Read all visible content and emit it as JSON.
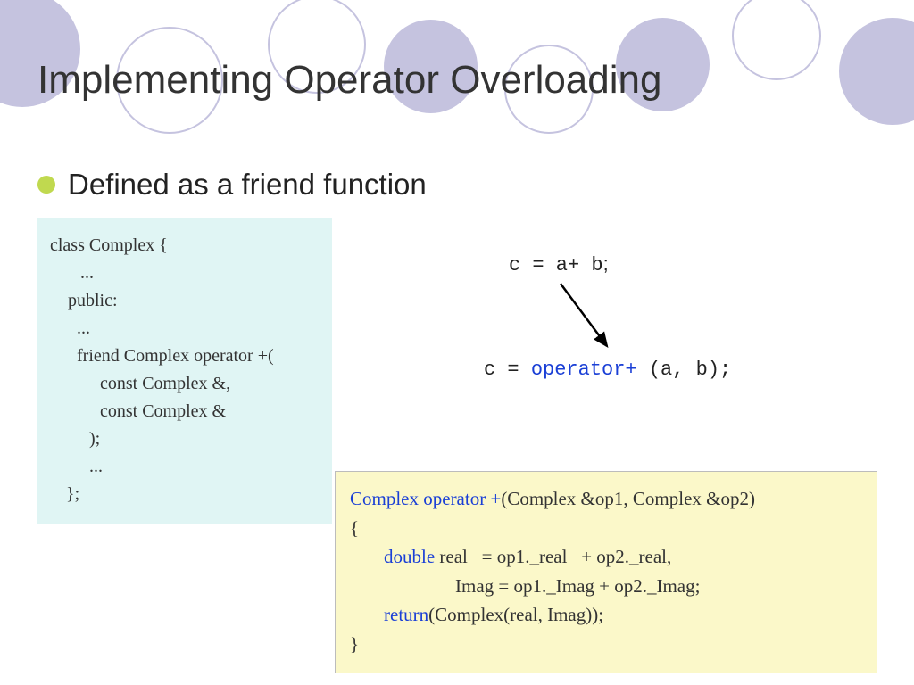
{
  "title": "Implementing Operator Overloading",
  "bullet": "Defined as a friend function",
  "classCode": {
    "l1": "class Complex {",
    "l2": "...",
    "l3": "public:",
    "l4": "...",
    "l5": "friend Complex operator +(",
    "l6": "const Complex &,",
    "l7": "const Complex &",
    "l8": ");",
    "l9": "...",
    "l10": "};"
  },
  "expression": {
    "call_prefix": "c = a",
    "call_plus": "+",
    "call_mid": " b",
    "call_semi": ";",
    "resolved_prefix": "c = ",
    "resolved_op": "operator+",
    "resolved_args": " (a, b);"
  },
  "implCode": {
    "l1_a": "Complex operator +",
    "l1_b": "(Complex &op1, Complex &op2)",
    "l2": "{",
    "l3_a": "double real   = op1._real   + op2._real,",
    "l4_a": "Imag = op1._Imag + op2._Imag;",
    "l5_a": "return",
    "l5_b": "(Complex(real, Imag));",
    "l6": "}"
  }
}
